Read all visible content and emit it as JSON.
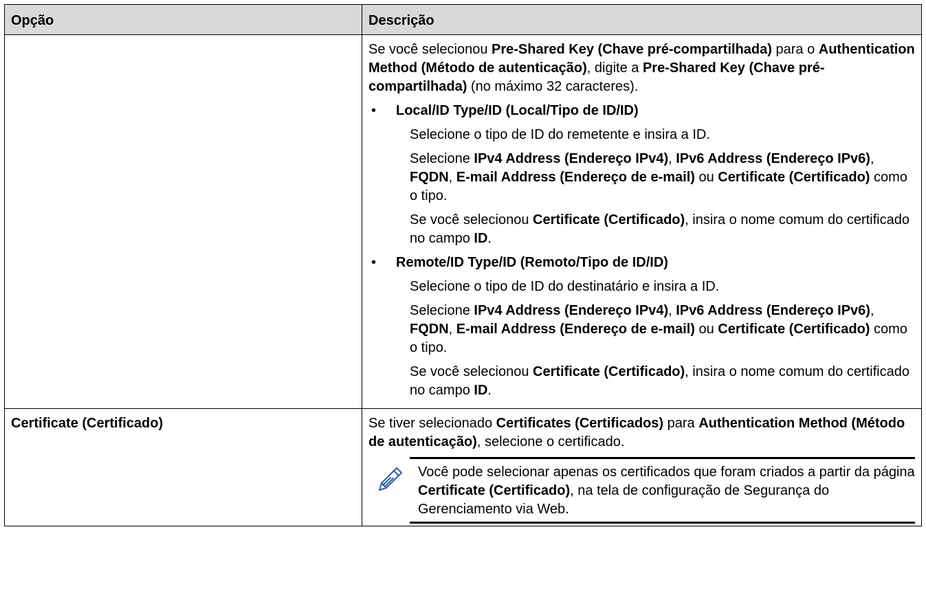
{
  "table": {
    "header": {
      "option": "Opção",
      "description": "Descrição"
    },
    "row1": {
      "option": "",
      "intro": {
        "t1": "Se você selecionou ",
        "b1": "Pre-Shared Key (Chave pré-compartilhada)",
        "t2": " para o ",
        "b2": "Authentication Method (Método de autenticação)",
        "t3": ", digite a ",
        "b3": "Pre-Shared Key (Chave pré-compartilhada)",
        "t4": " (no máximo 32 caracteres)."
      },
      "bullets": [
        {
          "marker": "•",
          "title": "Local/ID Type/ID (Local/Tipo de ID/ID)",
          "line1": "Selecione o tipo de ID do remetente e insira a ID.",
          "line2": {
            "t1": "Selecione ",
            "b1": "IPv4 Address (Endereço IPv4)",
            "t2": ", ",
            "b2": "IPv6 Address (Endereço IPv6)",
            "t3": ", ",
            "b3": "FQDN",
            "t4": ", ",
            "b4": "E-mail Address (Endereço de e-mail)",
            "t5": " ou ",
            "b5": "Certificate (Certificado)",
            "t6": " como o tipo."
          },
          "line3": {
            "t1": "Se você selecionou ",
            "b1": "Certificate (Certificado)",
            "t2": ", insira o nome comum do certificado no campo ",
            "b2": "ID",
            "t3": "."
          }
        },
        {
          "marker": "•",
          "title": "Remote/ID Type/ID (Remoto/Tipo de ID/ID)",
          "line1": "Selecione o tipo de ID do destinatário e insira a ID.",
          "line2": {
            "t1": "Selecione ",
            "b1": "IPv4 Address (Endereço IPv4)",
            "t2": ", ",
            "b2": "IPv6 Address (Endereço IPv6)",
            "t3": ", ",
            "b3": "FQDN",
            "t4": ", ",
            "b4": "E-mail Address (Endereço de e-mail)",
            "t5": " ou ",
            "b5": "Certificate (Certificado)",
            "t6": " como o tipo."
          },
          "line3": {
            "t1": "Se você selecionou ",
            "b1": "Certificate (Certificado)",
            "t2": ", insira o nome comum do certificado no campo ",
            "b2": "ID",
            "t3": "."
          }
        }
      ]
    },
    "row2": {
      "option": "Certificate (Certificado)",
      "desc": {
        "t1": "Se tiver selecionado ",
        "b1": "Certificates (Certificados)",
        "t2": " para ",
        "b2": "Authentication Method (Método de autenticação)",
        "t3": ", selecione o certificado."
      },
      "note": {
        "icon": "pencil-note-icon",
        "t1": "Você pode selecionar apenas os certificados que foram criados a partir da página ",
        "b1": "Certificate (Certificado)",
        "t2": ", na tela de configuração de Segurança do Gerenciamento via Web."
      }
    }
  }
}
